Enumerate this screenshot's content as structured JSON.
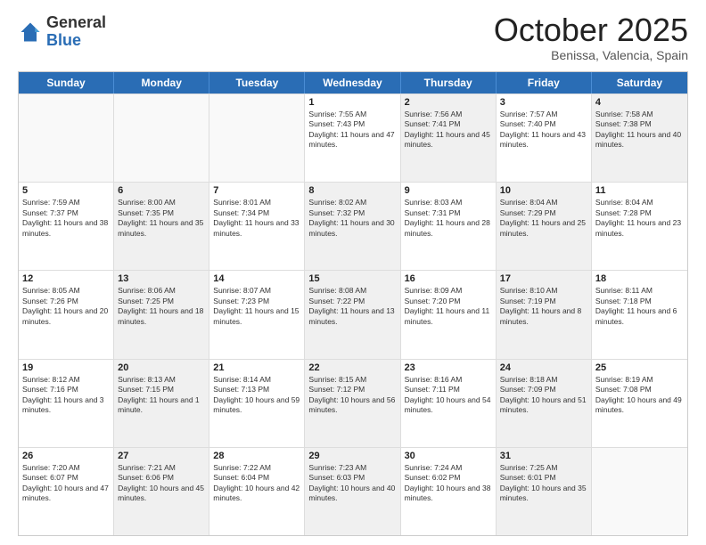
{
  "header": {
    "logo_general": "General",
    "logo_blue": "Blue",
    "month_title": "October 2025",
    "location": "Benissa, Valencia, Spain"
  },
  "days_of_week": [
    "Sunday",
    "Monday",
    "Tuesday",
    "Wednesday",
    "Thursday",
    "Friday",
    "Saturday"
  ],
  "weeks": [
    [
      {
        "day": "",
        "sunrise": "",
        "sunset": "",
        "daylight": "",
        "shaded": false,
        "empty": true
      },
      {
        "day": "",
        "sunrise": "",
        "sunset": "",
        "daylight": "",
        "shaded": false,
        "empty": true
      },
      {
        "day": "",
        "sunrise": "",
        "sunset": "",
        "daylight": "",
        "shaded": false,
        "empty": true
      },
      {
        "day": "1",
        "sunrise": "Sunrise: 7:55 AM",
        "sunset": "Sunset: 7:43 PM",
        "daylight": "Daylight: 11 hours and 47 minutes.",
        "shaded": false,
        "empty": false
      },
      {
        "day": "2",
        "sunrise": "Sunrise: 7:56 AM",
        "sunset": "Sunset: 7:41 PM",
        "daylight": "Daylight: 11 hours and 45 minutes.",
        "shaded": true,
        "empty": false
      },
      {
        "day": "3",
        "sunrise": "Sunrise: 7:57 AM",
        "sunset": "Sunset: 7:40 PM",
        "daylight": "Daylight: 11 hours and 43 minutes.",
        "shaded": false,
        "empty": false
      },
      {
        "day": "4",
        "sunrise": "Sunrise: 7:58 AM",
        "sunset": "Sunset: 7:38 PM",
        "daylight": "Daylight: 11 hours and 40 minutes.",
        "shaded": true,
        "empty": false
      }
    ],
    [
      {
        "day": "5",
        "sunrise": "Sunrise: 7:59 AM",
        "sunset": "Sunset: 7:37 PM",
        "daylight": "Daylight: 11 hours and 38 minutes.",
        "shaded": false,
        "empty": false
      },
      {
        "day": "6",
        "sunrise": "Sunrise: 8:00 AM",
        "sunset": "Sunset: 7:35 PM",
        "daylight": "Daylight: 11 hours and 35 minutes.",
        "shaded": true,
        "empty": false
      },
      {
        "day": "7",
        "sunrise": "Sunrise: 8:01 AM",
        "sunset": "Sunset: 7:34 PM",
        "daylight": "Daylight: 11 hours and 33 minutes.",
        "shaded": false,
        "empty": false
      },
      {
        "day": "8",
        "sunrise": "Sunrise: 8:02 AM",
        "sunset": "Sunset: 7:32 PM",
        "daylight": "Daylight: 11 hours and 30 minutes.",
        "shaded": true,
        "empty": false
      },
      {
        "day": "9",
        "sunrise": "Sunrise: 8:03 AM",
        "sunset": "Sunset: 7:31 PM",
        "daylight": "Daylight: 11 hours and 28 minutes.",
        "shaded": false,
        "empty": false
      },
      {
        "day": "10",
        "sunrise": "Sunrise: 8:04 AM",
        "sunset": "Sunset: 7:29 PM",
        "daylight": "Daylight: 11 hours and 25 minutes.",
        "shaded": true,
        "empty": false
      },
      {
        "day": "11",
        "sunrise": "Sunrise: 8:04 AM",
        "sunset": "Sunset: 7:28 PM",
        "daylight": "Daylight: 11 hours and 23 minutes.",
        "shaded": false,
        "empty": false
      }
    ],
    [
      {
        "day": "12",
        "sunrise": "Sunrise: 8:05 AM",
        "sunset": "Sunset: 7:26 PM",
        "daylight": "Daylight: 11 hours and 20 minutes.",
        "shaded": false,
        "empty": false
      },
      {
        "day": "13",
        "sunrise": "Sunrise: 8:06 AM",
        "sunset": "Sunset: 7:25 PM",
        "daylight": "Daylight: 11 hours and 18 minutes.",
        "shaded": true,
        "empty": false
      },
      {
        "day": "14",
        "sunrise": "Sunrise: 8:07 AM",
        "sunset": "Sunset: 7:23 PM",
        "daylight": "Daylight: 11 hours and 15 minutes.",
        "shaded": false,
        "empty": false
      },
      {
        "day": "15",
        "sunrise": "Sunrise: 8:08 AM",
        "sunset": "Sunset: 7:22 PM",
        "daylight": "Daylight: 11 hours and 13 minutes.",
        "shaded": true,
        "empty": false
      },
      {
        "day": "16",
        "sunrise": "Sunrise: 8:09 AM",
        "sunset": "Sunset: 7:20 PM",
        "daylight": "Daylight: 11 hours and 11 minutes.",
        "shaded": false,
        "empty": false
      },
      {
        "day": "17",
        "sunrise": "Sunrise: 8:10 AM",
        "sunset": "Sunset: 7:19 PM",
        "daylight": "Daylight: 11 hours and 8 minutes.",
        "shaded": true,
        "empty": false
      },
      {
        "day": "18",
        "sunrise": "Sunrise: 8:11 AM",
        "sunset": "Sunset: 7:18 PM",
        "daylight": "Daylight: 11 hours and 6 minutes.",
        "shaded": false,
        "empty": false
      }
    ],
    [
      {
        "day": "19",
        "sunrise": "Sunrise: 8:12 AM",
        "sunset": "Sunset: 7:16 PM",
        "daylight": "Daylight: 11 hours and 3 minutes.",
        "shaded": false,
        "empty": false
      },
      {
        "day": "20",
        "sunrise": "Sunrise: 8:13 AM",
        "sunset": "Sunset: 7:15 PM",
        "daylight": "Daylight: 11 hours and 1 minute.",
        "shaded": true,
        "empty": false
      },
      {
        "day": "21",
        "sunrise": "Sunrise: 8:14 AM",
        "sunset": "Sunset: 7:13 PM",
        "daylight": "Daylight: 10 hours and 59 minutes.",
        "shaded": false,
        "empty": false
      },
      {
        "day": "22",
        "sunrise": "Sunrise: 8:15 AM",
        "sunset": "Sunset: 7:12 PM",
        "daylight": "Daylight: 10 hours and 56 minutes.",
        "shaded": true,
        "empty": false
      },
      {
        "day": "23",
        "sunrise": "Sunrise: 8:16 AM",
        "sunset": "Sunset: 7:11 PM",
        "daylight": "Daylight: 10 hours and 54 minutes.",
        "shaded": false,
        "empty": false
      },
      {
        "day": "24",
        "sunrise": "Sunrise: 8:18 AM",
        "sunset": "Sunset: 7:09 PM",
        "daylight": "Daylight: 10 hours and 51 minutes.",
        "shaded": true,
        "empty": false
      },
      {
        "day": "25",
        "sunrise": "Sunrise: 8:19 AM",
        "sunset": "Sunset: 7:08 PM",
        "daylight": "Daylight: 10 hours and 49 minutes.",
        "shaded": false,
        "empty": false
      }
    ],
    [
      {
        "day": "26",
        "sunrise": "Sunrise: 7:20 AM",
        "sunset": "Sunset: 6:07 PM",
        "daylight": "Daylight: 10 hours and 47 minutes.",
        "shaded": false,
        "empty": false
      },
      {
        "day": "27",
        "sunrise": "Sunrise: 7:21 AM",
        "sunset": "Sunset: 6:06 PM",
        "daylight": "Daylight: 10 hours and 45 minutes.",
        "shaded": true,
        "empty": false
      },
      {
        "day": "28",
        "sunrise": "Sunrise: 7:22 AM",
        "sunset": "Sunset: 6:04 PM",
        "daylight": "Daylight: 10 hours and 42 minutes.",
        "shaded": false,
        "empty": false
      },
      {
        "day": "29",
        "sunrise": "Sunrise: 7:23 AM",
        "sunset": "Sunset: 6:03 PM",
        "daylight": "Daylight: 10 hours and 40 minutes.",
        "shaded": true,
        "empty": false
      },
      {
        "day": "30",
        "sunrise": "Sunrise: 7:24 AM",
        "sunset": "Sunset: 6:02 PM",
        "daylight": "Daylight: 10 hours and 38 minutes.",
        "shaded": false,
        "empty": false
      },
      {
        "day": "31",
        "sunrise": "Sunrise: 7:25 AM",
        "sunset": "Sunset: 6:01 PM",
        "daylight": "Daylight: 10 hours and 35 minutes.",
        "shaded": true,
        "empty": false
      },
      {
        "day": "",
        "sunrise": "",
        "sunset": "",
        "daylight": "",
        "shaded": false,
        "empty": true
      }
    ]
  ]
}
